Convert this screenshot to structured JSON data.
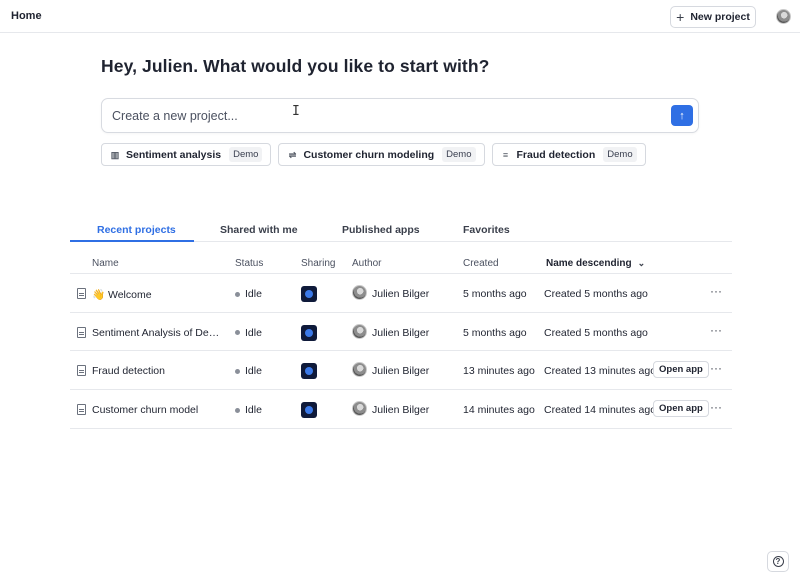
{
  "topbar": {
    "home_label": "Home",
    "new_project_label": "New project"
  },
  "hero": {
    "greeting": "Hey, Julien. What would you like to start with?",
    "prompt_placeholder": "Create a new project...",
    "send_icon": "arrow-up-icon"
  },
  "chips": [
    {
      "label": "Sentiment analysis",
      "badge": "Demo",
      "icon": "chart-icon"
    },
    {
      "label": "Customer churn modeling",
      "badge": "Demo",
      "icon": "flow-icon"
    },
    {
      "label": "Fraud detection",
      "badge": "Demo",
      "icon": "database-icon"
    }
  ],
  "tabs": [
    {
      "label": "Recent projects",
      "active": true
    },
    {
      "label": "Shared with me",
      "active": false
    },
    {
      "label": "Published apps",
      "active": false
    },
    {
      "label": "Favorites",
      "active": false
    }
  ],
  "table": {
    "headers": {
      "name": "Name",
      "status": "Status",
      "sharing": "Sharing",
      "author": "Author",
      "created": "Created",
      "sort": "Name descending"
    },
    "rows": [
      {
        "name": "👋 Welcome",
        "status": "Idle",
        "author": "Julien Bilger",
        "created": "5 months ago",
        "sort_value": "Created 5 months ago",
        "open_app": ""
      },
      {
        "name": "Sentiment Analysis of Deepn...",
        "status": "Idle",
        "author": "Julien Bilger",
        "created": "5 months ago",
        "sort_value": "Created 5 months ago",
        "open_app": ""
      },
      {
        "name": "Fraud detection",
        "status": "Idle",
        "author": "Julien Bilger",
        "created": "13 minutes ago",
        "sort_value": "Created 13 minutes ago",
        "open_app": "Open app"
      },
      {
        "name": "Customer churn model",
        "status": "Idle",
        "author": "Julien Bilger",
        "created": "14 minutes ago",
        "sort_value": "Created 14 minutes ago",
        "open_app": "Open app"
      }
    ],
    "more_label": "···"
  },
  "help_label": "?"
}
